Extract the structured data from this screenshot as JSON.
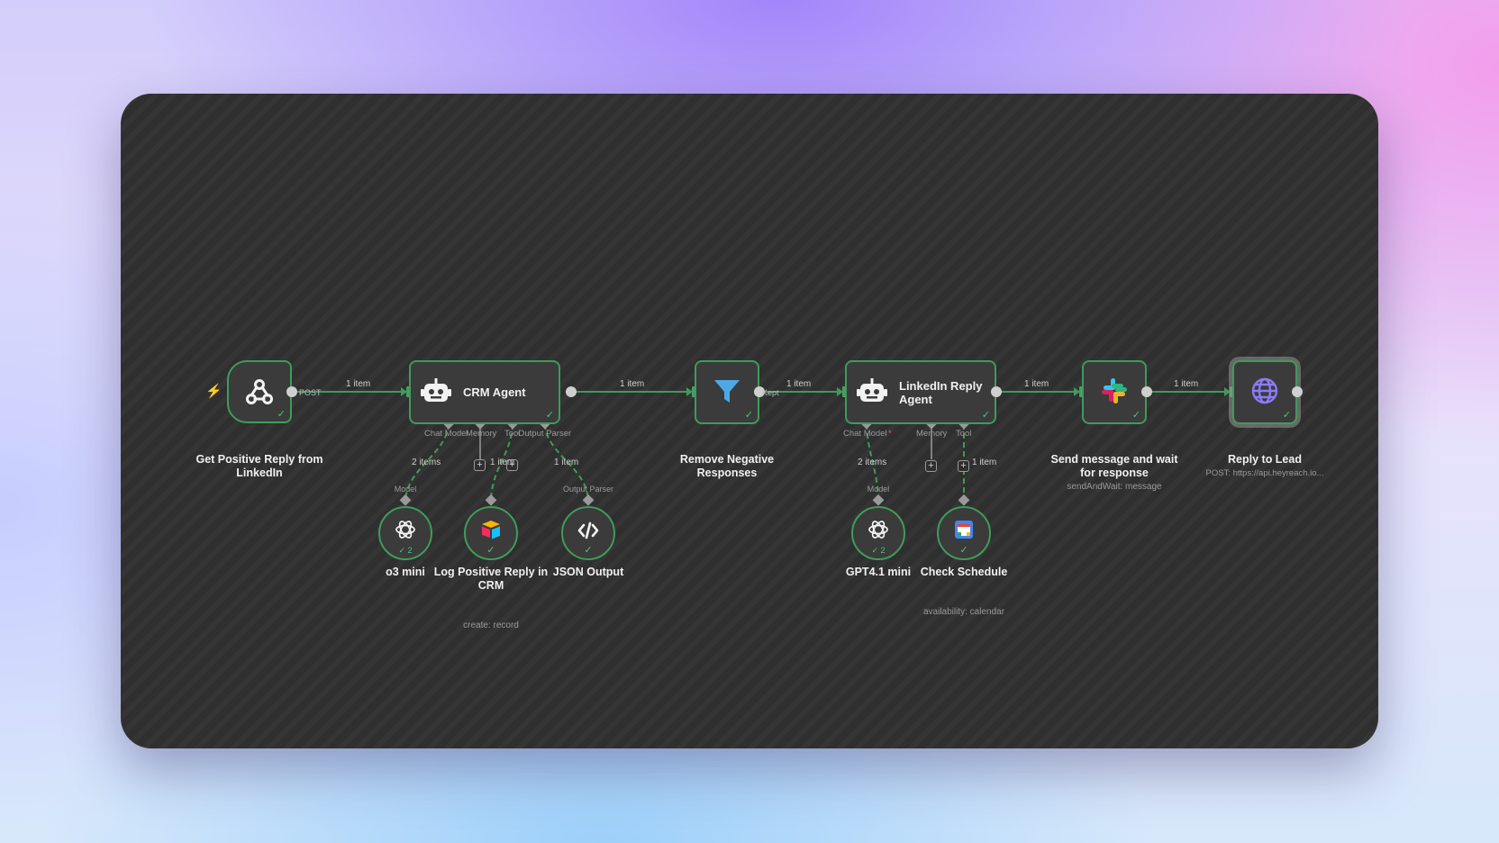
{
  "colors": {
    "edge": "#3f9b5b",
    "node_border": "#3f9b5b",
    "port": "#cfcfcf",
    "trigger_bolt": "#e85d4d"
  },
  "trigger_node": {
    "icon": "webhook-icon",
    "label": "Get Positive Reply from LinkedIn",
    "output_label": "POST"
  },
  "crm_agent": {
    "icon": "robot-icon",
    "title": "CRM Agent",
    "ports": {
      "chat_model": "Chat Model",
      "memory": "Memory",
      "tool": "Tool",
      "output_parser": "Output Parser"
    }
  },
  "filter_node": {
    "icon": "filter-icon",
    "label": "Remove Negative Responses",
    "output_label": "Kept"
  },
  "linkedin_agent": {
    "icon": "robot-icon",
    "title": "LinkedIn Reply Agent",
    "ports": {
      "chat_model": "Chat Model",
      "memory": "Memory",
      "tool": "Tool"
    }
  },
  "slack_node": {
    "icon": "slack-icon",
    "label": "Send message and wait for response",
    "sublabel": "sendAndWait: message"
  },
  "http_node": {
    "icon": "globe-icon",
    "label": "Reply to Lead",
    "sublabel": "POST: https://api.heyreach.io..."
  },
  "sub_nodes": {
    "o3_mini": {
      "icon": "openai-icon",
      "label": "o3 mini",
      "count": "2",
      "port_label": "Model"
    },
    "airtable": {
      "icon": "airtable-icon",
      "label": "Log Positive Reply in CRM",
      "sublabel": "create: record"
    },
    "json_output": {
      "icon": "code-icon",
      "label": "JSON Output",
      "port_label": "Output Parser"
    },
    "gpt41_mini": {
      "icon": "openai-icon",
      "label": "GPT4.1 mini",
      "count": "2",
      "port_label": "Model"
    },
    "check_schedule": {
      "icon": "google-calendar-icon",
      "label": "Check Schedule",
      "sublabel": "availability: calendar"
    }
  },
  "edge_labels": {
    "e1": "1 item",
    "e2": "1 item",
    "e3": "1 item",
    "e4": "1 item",
    "e5": "1 item",
    "crm_model": "2 items",
    "crm_tool": "1 item",
    "crm_parser": "1 item",
    "li_model": "2 items",
    "li_tool": "1 item"
  }
}
